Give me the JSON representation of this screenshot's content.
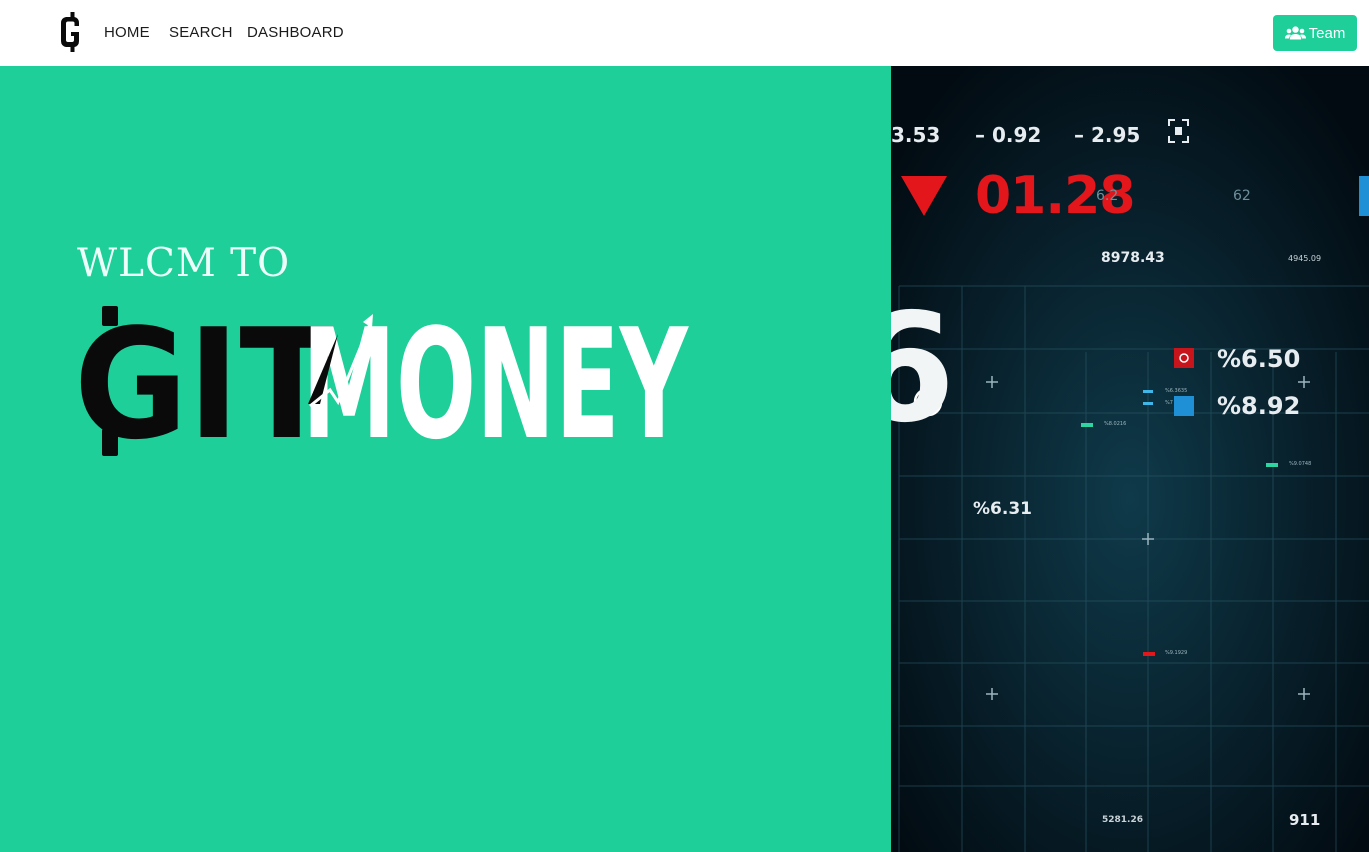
{
  "navbar": {
    "brand_icon": "gitmoney-cedi-logo-icon",
    "links": [
      {
        "label": "HOME"
      },
      {
        "label": "SEARCH"
      },
      {
        "label": "DASHBOARD"
      }
    ],
    "team_button": {
      "label": "Team",
      "icon": "users-icon"
    }
  },
  "hero": {
    "welcome_text": "WLCM TO",
    "logo": {
      "part_dark": "GIT",
      "part_light": "MONEY"
    },
    "background_color": "#1ecf99"
  },
  "market_image": {
    "top_values": [
      "3.53",
      "– 0.92",
      "– 2.95"
    ],
    "big_red_value": "01.28",
    "small_values": [
      "6.2",
      "62",
      "8978.43",
      "4945.09"
    ],
    "big_digit": "6",
    "percent_values": [
      "%6.50",
      "%8.92",
      "%6.31"
    ],
    "tiny_labels": [
      "%8.0216",
      "%9.0748",
      "%9.1929",
      "%6.3635",
      "%7"
    ],
    "bottom_values": [
      "5281.26",
      "911"
    ]
  },
  "colors": {
    "accent": "#1ecf99",
    "dark": "#0a0a0a",
    "market_bg": "#03141e",
    "market_red": "#e3161b",
    "market_text": "#e6ecef"
  }
}
